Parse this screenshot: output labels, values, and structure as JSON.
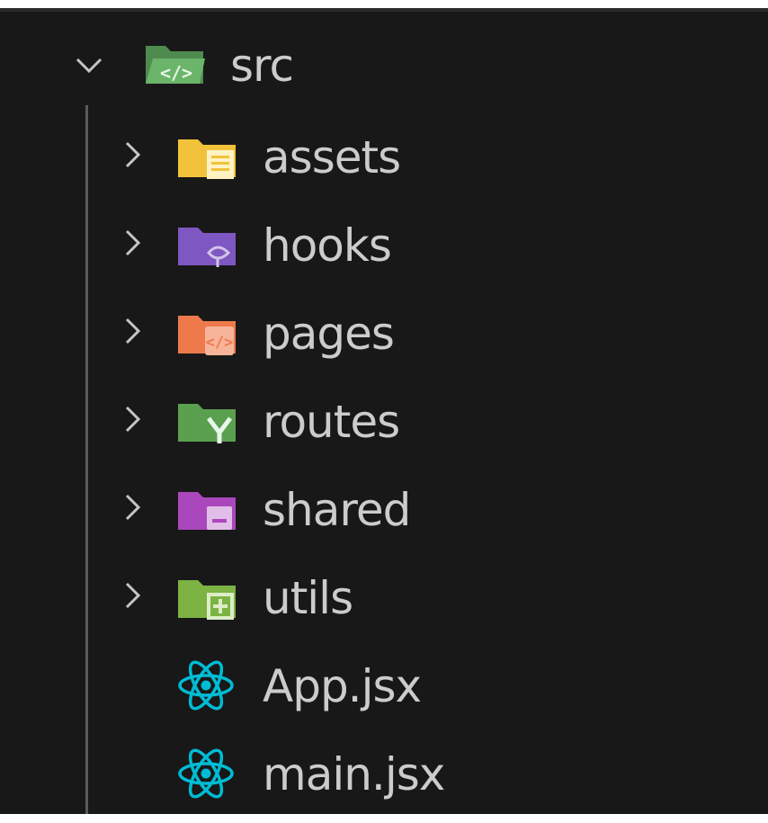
{
  "explorer": {
    "root": {
      "label": "src",
      "expanded": true,
      "icon": "folder-src-open-icon",
      "color": "#6bb56b"
    },
    "folders": [
      {
        "label": "assets",
        "icon": "folder-assets-icon",
        "color": "#f2c33a"
      },
      {
        "label": "hooks",
        "icon": "folder-hooks-icon",
        "color": "#7e57c2"
      },
      {
        "label": "pages",
        "icon": "folder-pages-icon",
        "color": "#ee7a4c"
      },
      {
        "label": "routes",
        "icon": "folder-routes-icon",
        "color": "#5aa04f"
      },
      {
        "label": "shared",
        "icon": "folder-shared-icon",
        "color": "#ab47bc"
      },
      {
        "label": "utils",
        "icon": "folder-utils-icon",
        "color": "#7cb342"
      }
    ],
    "files": [
      {
        "label": "App.jsx",
        "icon": "react-icon",
        "color": "#00bcd4"
      },
      {
        "label": "main.jsx",
        "icon": "react-icon",
        "color": "#00bcd4"
      }
    ]
  }
}
